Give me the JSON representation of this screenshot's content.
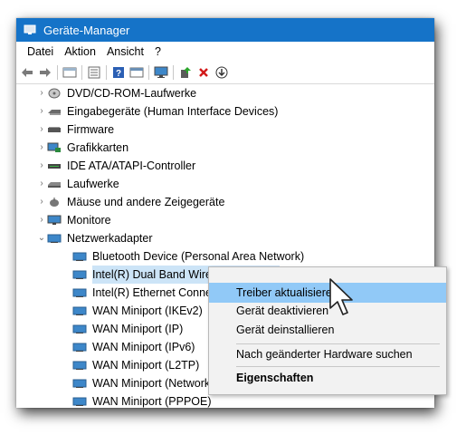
{
  "window": {
    "title": "Geräte-Manager"
  },
  "menubar": {
    "items": [
      "Datei",
      "Aktion",
      "Ansicht",
      "?"
    ]
  },
  "toolbar": {
    "buttons": [
      "back-icon",
      "forward-icon",
      "properties-icon",
      "list-icon",
      "help-icon",
      "view-icon",
      "monitor-icon",
      "add-driver-icon",
      "remove-icon",
      "download-icon"
    ]
  },
  "tree": {
    "categories": [
      {
        "label": "DVD/CD-ROM-Laufwerke",
        "expanded": false
      },
      {
        "label": "Eingabegeräte (Human Interface Devices)",
        "expanded": false
      },
      {
        "label": "Firmware",
        "expanded": false
      },
      {
        "label": "Grafikkarten",
        "expanded": false
      },
      {
        "label": "IDE ATA/ATAPI-Controller",
        "expanded": false
      },
      {
        "label": "Laufwerke",
        "expanded": false
      },
      {
        "label": "Mäuse und andere Zeigegeräte",
        "expanded": false
      },
      {
        "label": "Monitore",
        "expanded": false
      },
      {
        "label": "Netzwerkadapter",
        "expanded": true
      }
    ],
    "network_adapters": [
      "Bluetooth Device (Personal Area Network)",
      "Intel(R) Dual Band Wireless-AC 8265",
      "Intel(R) Ethernet Connection",
      "WAN Miniport (IKEv2)",
      "WAN Miniport (IP)",
      "WAN Miniport (IPv6)",
      "WAN Miniport (L2TP)",
      "WAN Miniport (Network Monitor)",
      "WAN Miniport (PPPOE)"
    ],
    "selected": "Intel(R) Dual Band Wireless-AC 8265"
  },
  "context_menu": {
    "items": [
      "Treiber aktualisieren",
      "Gerät deaktivieren",
      "Gerät deinstallieren",
      "Nach geänderter Hardware suchen",
      "Eigenschaften"
    ],
    "highlighted": "Treiber aktualisieren",
    "default": "Eigenschaften"
  },
  "colors": {
    "titlebar": "#1573c8",
    "selection": "#cce4f7",
    "menu_highlight": "#91c9f7"
  }
}
